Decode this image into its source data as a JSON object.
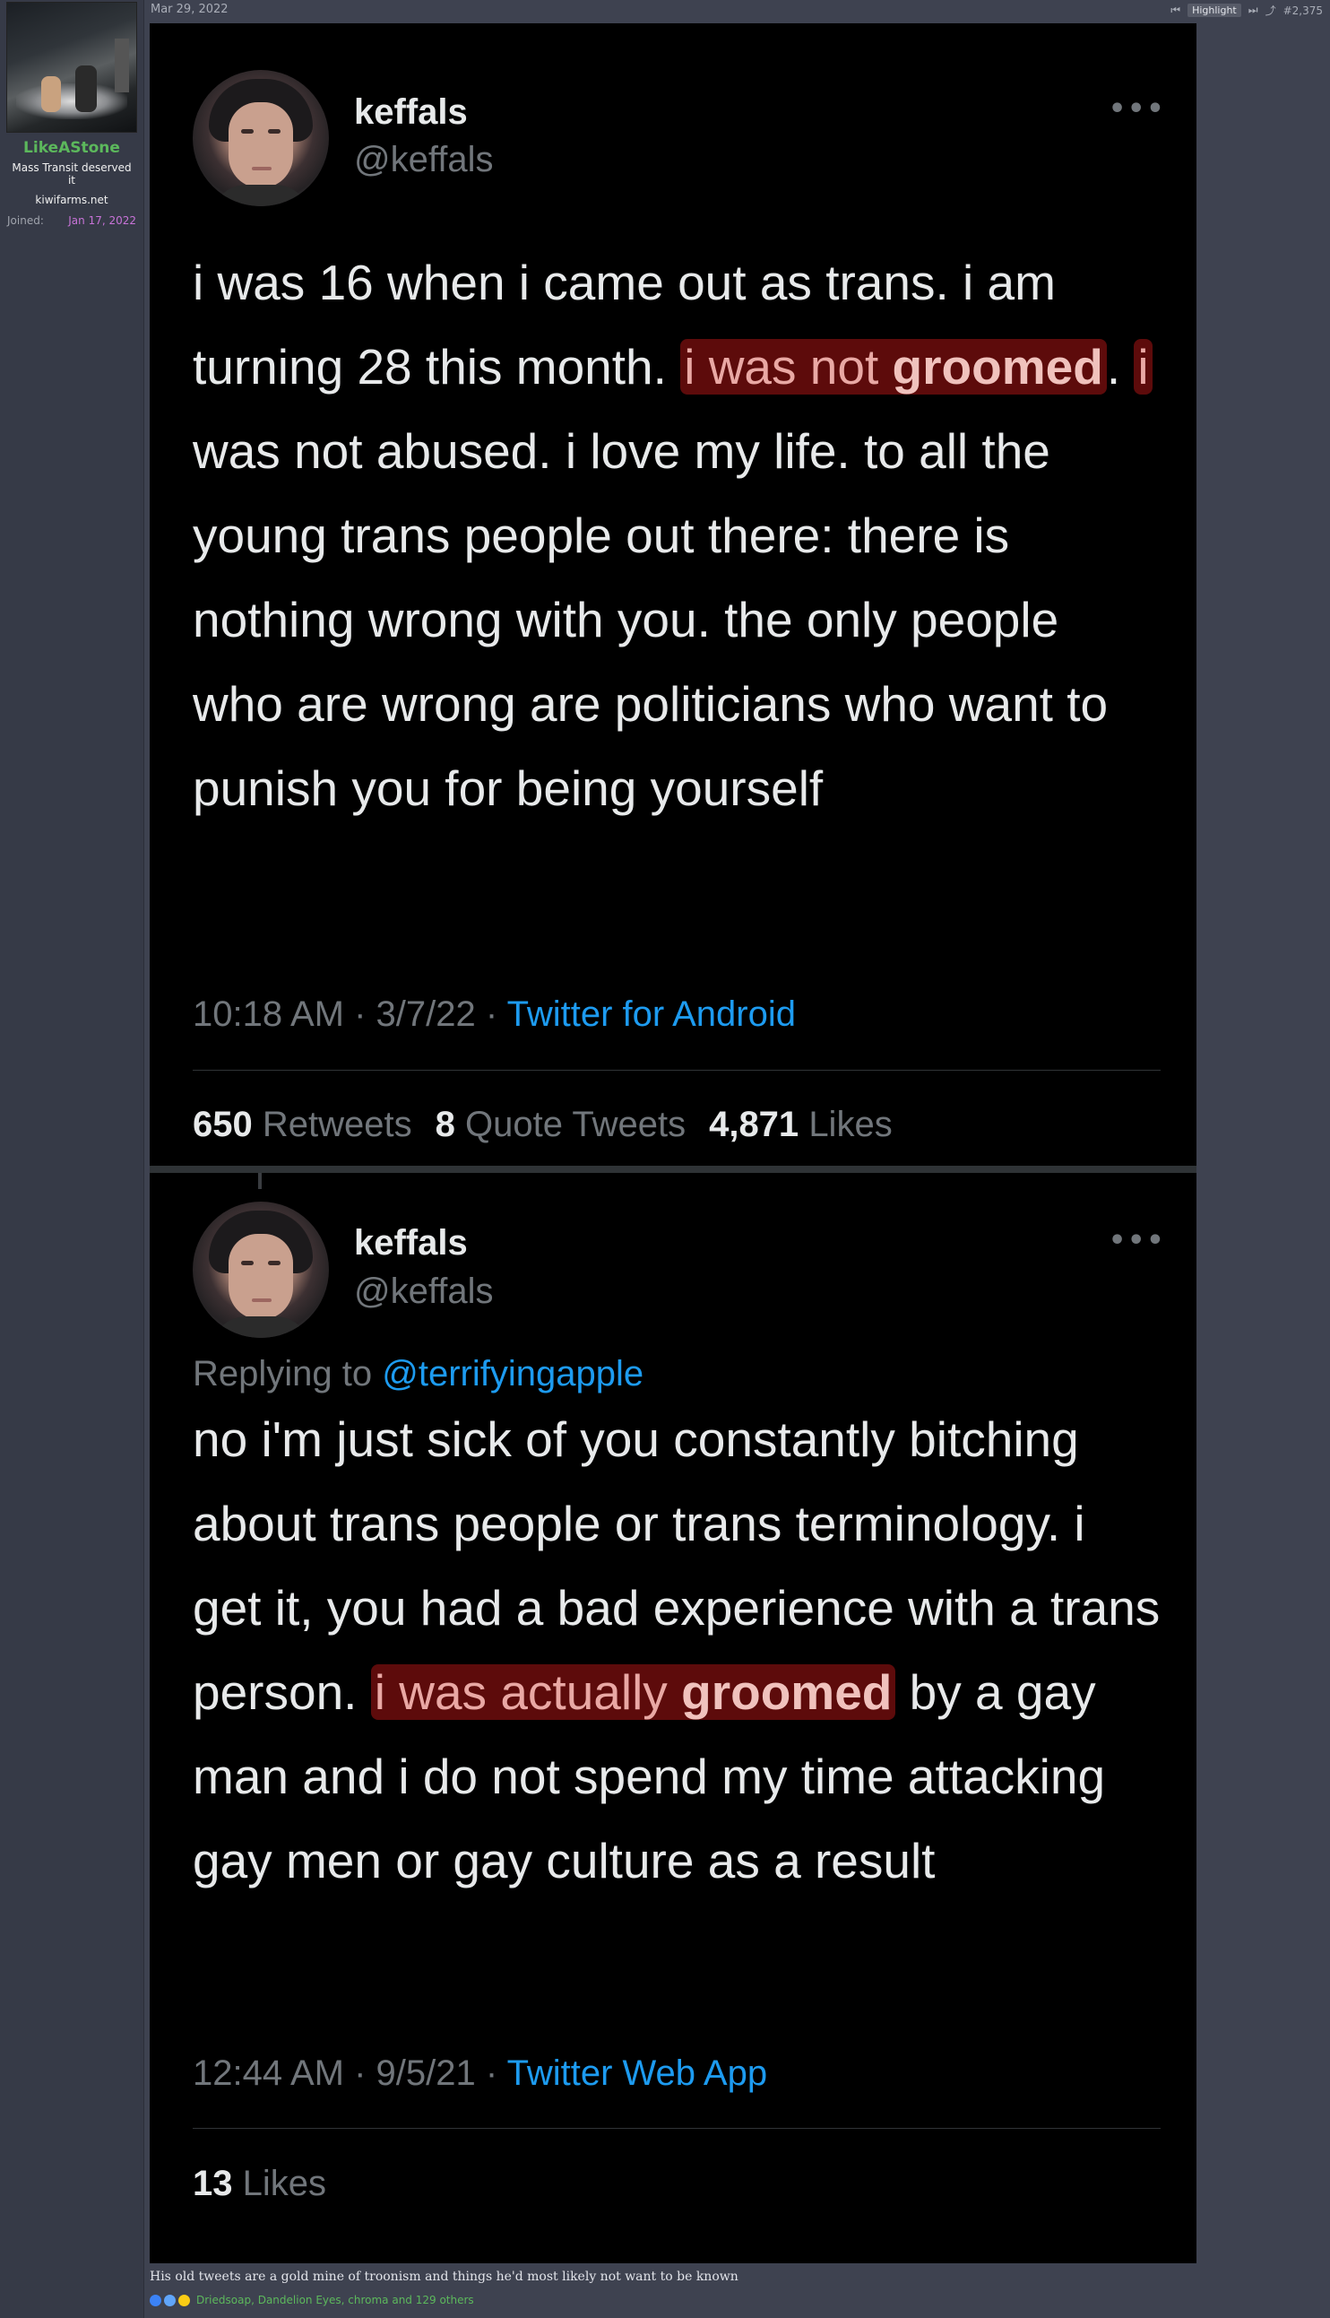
{
  "post": {
    "date": "Mar 29, 2022",
    "highlight_label": "Highlight",
    "post_number": "#2,375"
  },
  "user": {
    "name": "LikeAStone",
    "title": "Mass Transit deserved it",
    "site": "kiwifarms.net",
    "joined_label": "Joined:",
    "joined_date": "Jan 17, 2022"
  },
  "tweet1": {
    "name": "keffals",
    "handle": "@keffals",
    "more": "•••",
    "text_before": "i was 16 when i came out as trans. i am turning 28 this month. ",
    "hl_pre": "i was not ",
    "hl_bold": "groomed",
    "text_mid": ". ",
    "hl_post": "i",
    "text_after": " was not abused. i love my life. to all the young trans people out there: there is nothing wrong with you. the only people who are wrong are politicians who want to punish you for being yourself",
    "time": "10:18 AM · 3/7/22 · ",
    "source": "Twitter for Android",
    "retweets_num": "650",
    "retweets_label": "Retweets",
    "quotes_num": "8",
    "quotes_label": "Quote Tweets",
    "likes_num": "4,871",
    "likes_label": "Likes"
  },
  "tweet2": {
    "name": "keffals",
    "handle": "@keffals",
    "more": "•••",
    "replying_label": "Replying to ",
    "replying_mention": "@terrifyingapple",
    "text_before": "no i'm just sick of you constantly bitching about trans people or trans terminology. i get it, you had a bad experience with a trans person. ",
    "hl_pre": "i was actually ",
    "hl_bold": "groomed",
    "text_after": " by a gay man and i do not spend my time attacking gay men or gay culture as a result",
    "time": "12:44 AM · 9/5/21 · ",
    "source": "Twitter Web App",
    "likes_num": "13",
    "likes_label": "Likes"
  },
  "caption": "His old tweets are a gold mine of troonism and things he'd most likely not want to be known",
  "reactions": {
    "icons": [
      "informative-icon",
      "like-icon",
      "thinking-icon"
    ],
    "reactors": "Driedsoap, Dandelion Eyes, chroma and 129 others"
  },
  "colors": {
    "page_bg": "#3e4250",
    "username": "#5cb85c",
    "joined_date": "#c873d8",
    "twitter_link": "#1d9bf0",
    "highlight": "#aa1414"
  }
}
